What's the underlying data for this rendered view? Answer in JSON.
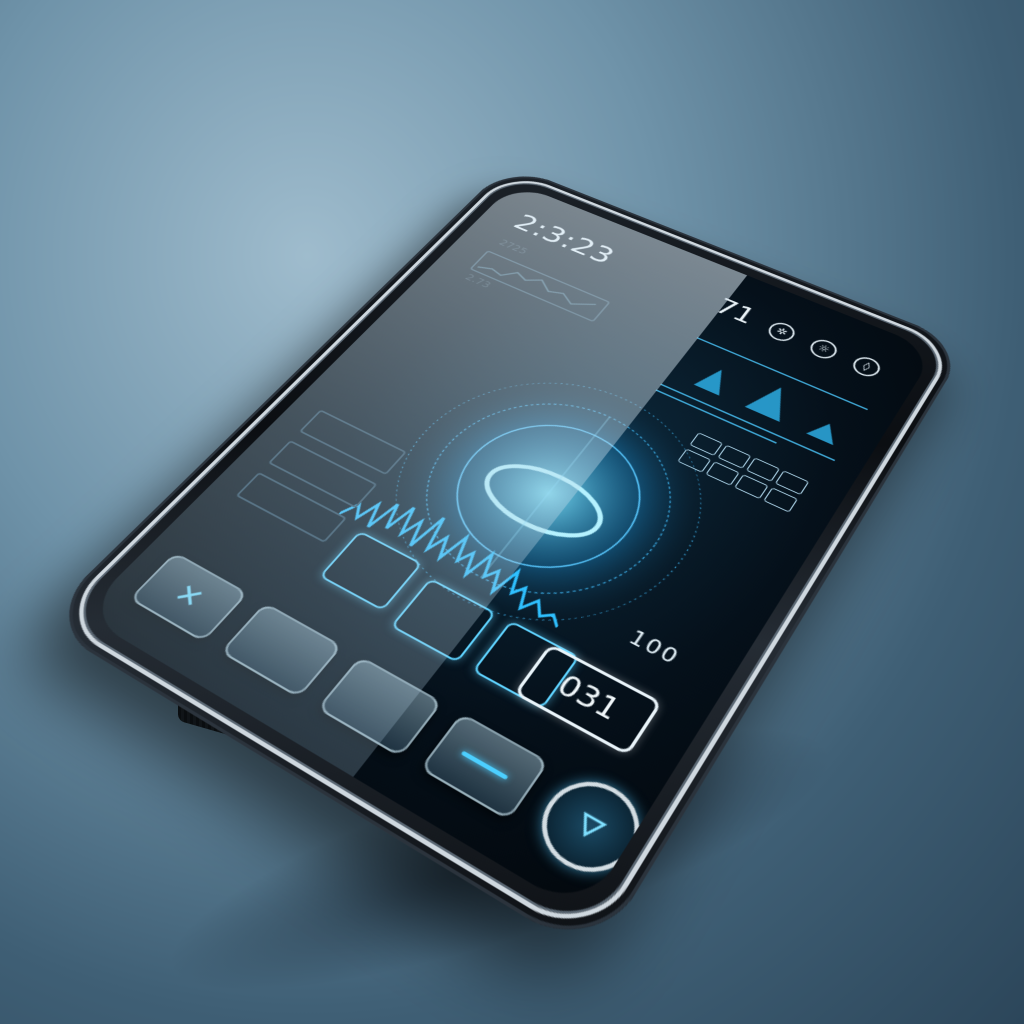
{
  "device": {
    "clock": "2:3:23",
    "top_right_number": "71",
    "left_small_label_1": "2725",
    "left_small_label_2": "2.73",
    "right_number": "100",
    "readout": "031",
    "colors": {
      "accent": "#4ccfff",
      "glass": "#cfe2ec",
      "body": "#0b0e12",
      "background": "#6f93a9"
    },
    "buttons": [
      {
        "icon": "x-cross-icon"
      },
      {
        "icon": "blank-icon"
      },
      {
        "icon": "blank-icon"
      },
      {
        "icon": "dash-icon"
      },
      {
        "icon": "play-triangle-icon"
      }
    ]
  }
}
